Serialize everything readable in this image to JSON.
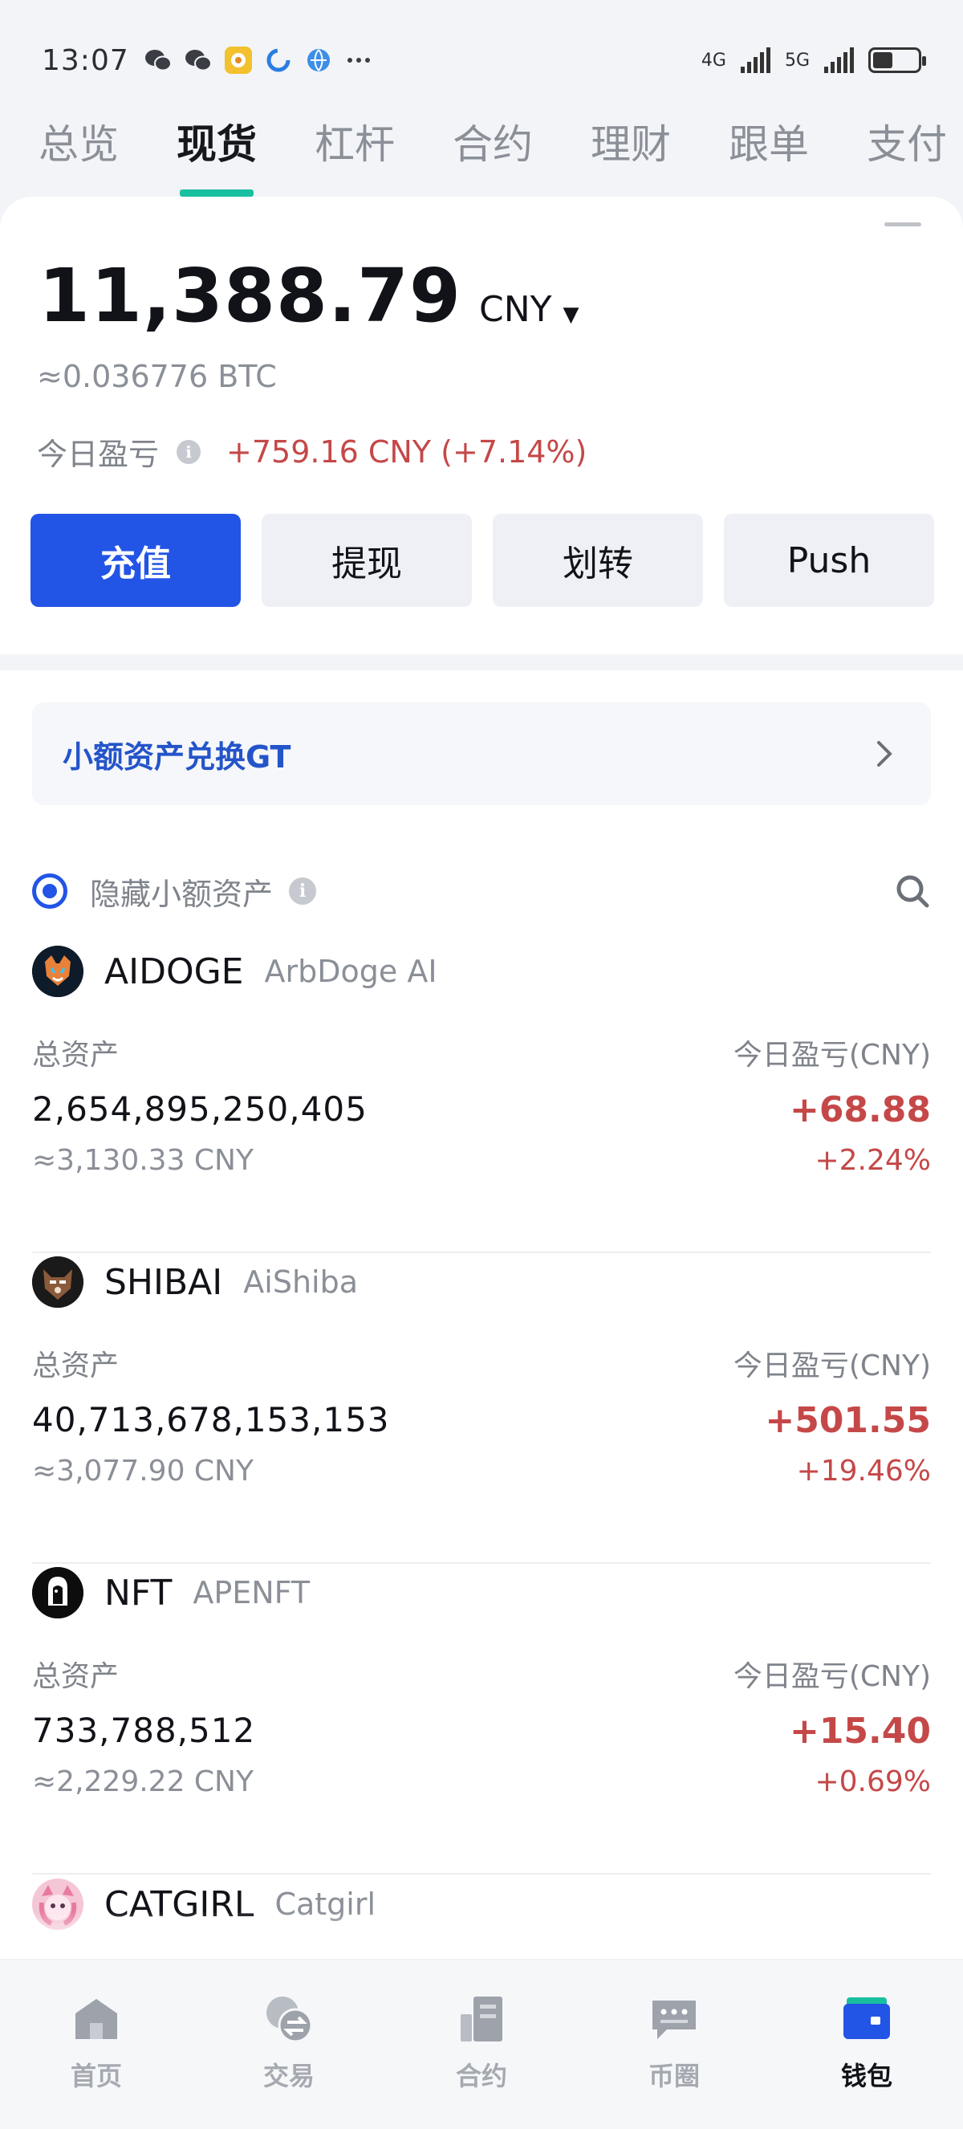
{
  "status_bar": {
    "time": "13:07",
    "notification_icons": [
      "wechat-icon",
      "wechat-icon",
      "app-icon",
      "app-icon",
      "browser-icon",
      "more-icon"
    ],
    "network_left": "4G",
    "network_right": "5G",
    "battery_level": 0.45
  },
  "top_tabs": [
    {
      "label": "总览",
      "active": false
    },
    {
      "label": "现货",
      "active": true
    },
    {
      "label": "杠杆",
      "active": false
    },
    {
      "label": "合约",
      "active": false
    },
    {
      "label": "理财",
      "active": false
    },
    {
      "label": "跟单",
      "active": false
    },
    {
      "label": "支付",
      "active": false
    }
  ],
  "balance": {
    "value": "11,388.79",
    "currency": "CNY",
    "caret": "▼",
    "btc_equiv": "≈0.036776 BTC",
    "pnl_label": "今日盈亏",
    "pnl_value": "+759.16 CNY (+7.14%)"
  },
  "actions": {
    "deposit": "充值",
    "withdraw": "提现",
    "transfer": "划转",
    "push": "Push"
  },
  "convert_banner": {
    "text": "小额资产兑换GT"
  },
  "filter": {
    "hide_small_label": "隐藏小额资产"
  },
  "assets": [
    {
      "symbol": "AIDOGE",
      "name": "ArbDoge AI",
      "total_label": "总资产",
      "amount": "2,654,895,250,405",
      "cny": "≈3,130.33 CNY",
      "pnl_label": "今日盈亏(CNY)",
      "pnl": "+68.88",
      "pct": "+2.24%"
    },
    {
      "symbol": "SHIBAI",
      "name": "AiShiba",
      "total_label": "总资产",
      "amount": "40,713,678,153,153",
      "cny": "≈3,077.90 CNY",
      "pnl_label": "今日盈亏(CNY)",
      "pnl": "+501.55",
      "pct": "+19.46%"
    },
    {
      "symbol": "NFT",
      "name": "APENFT",
      "total_label": "总资产",
      "amount": "733,788,512",
      "cny": "≈2,229.22 CNY",
      "pnl_label": "今日盈亏(CNY)",
      "pnl": "+15.40",
      "pct": "+0.69%"
    },
    {
      "symbol": "CATGIRL",
      "name": "Catgirl"
    }
  ],
  "bottom_nav": [
    {
      "label": "首页",
      "icon": "home-icon",
      "active": false
    },
    {
      "label": "交易",
      "icon": "exchange-icon",
      "active": false
    },
    {
      "label": "合约",
      "icon": "contract-icon",
      "active": false
    },
    {
      "label": "币圈",
      "icon": "chat-icon",
      "active": false
    },
    {
      "label": "钱包",
      "icon": "wallet-icon",
      "active": true
    }
  ],
  "colors": {
    "accent_blue": "#2254e6",
    "tab_indicator": "#19c0a0",
    "loss_gain_red": "#c54848"
  }
}
